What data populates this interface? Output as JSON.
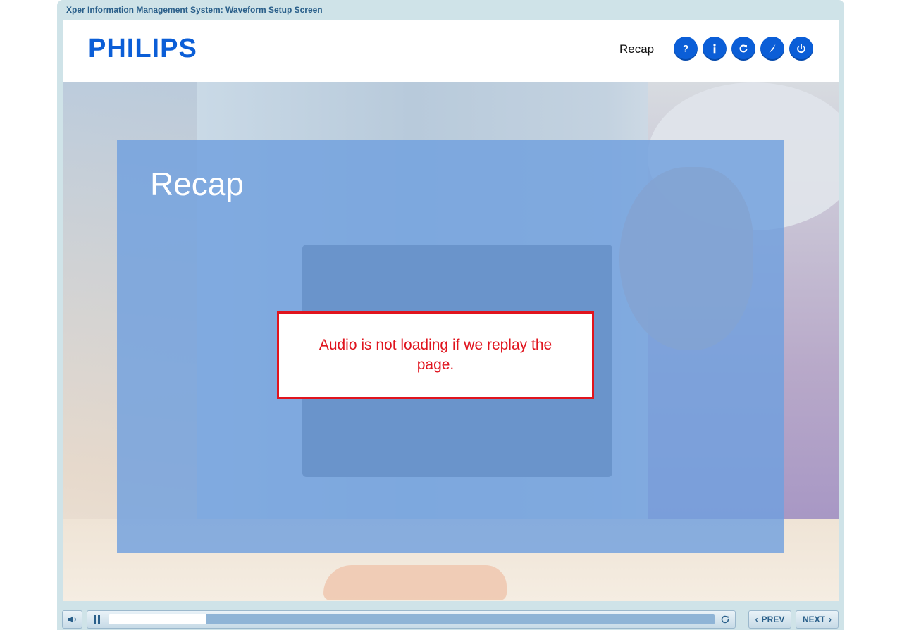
{
  "window": {
    "title": "Xper Information Management System: Waveform Setup Screen"
  },
  "header": {
    "logo": "PHILIPS",
    "section_label": "Recap",
    "icons": [
      "help-icon",
      "info-icon",
      "replay-icon",
      "navigate-icon",
      "power-icon"
    ],
    "brand_color": "#0b5ed7"
  },
  "slide": {
    "title": "Recap",
    "note": "Audio is not loading if we replay the page.",
    "note_color": "#e0141e"
  },
  "player": {
    "progress": 0.16,
    "prev_label": "PREV",
    "next_label": "NEXT"
  }
}
